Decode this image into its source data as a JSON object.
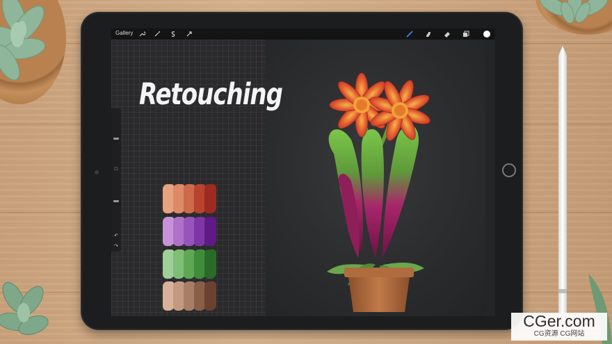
{
  "toolbar": {
    "gallery_label": "Gallery",
    "left_icons": [
      "wrench-icon",
      "magic-wand-icon",
      "selection-icon",
      "transform-arrow-icon"
    ],
    "right_icons": [
      "brush-icon",
      "smudge-icon",
      "eraser-icon",
      "layers-icon",
      "color-circle-icon"
    ],
    "active_color": "#ffffff",
    "brush_active_color": "#3c8ff5"
  },
  "canvas": {
    "title_text": "Retouching",
    "swatch_rows": [
      [
        "#e7a27f",
        "#dd8a68",
        "#cc6a4a",
        "#b8432f",
        "#9e2b22"
      ],
      [
        "#c793d8",
        "#b071c9",
        "#9755bb",
        "#7e36a6",
        "#5f1a86"
      ],
      [
        "#9fd098",
        "#7fbe76",
        "#5fa755",
        "#3f8d3a",
        "#2a6b28"
      ],
      [
        "#d8b19a",
        "#c39982",
        "#a87e67",
        "#8a5f47",
        "#6b4230"
      ]
    ]
  },
  "sidebar": {
    "undo_label": "↶",
    "redo_label": "↷",
    "modify_label": "□"
  },
  "watermark": {
    "main": "CGer.com",
    "sub": "CG资源 CG网站"
  }
}
